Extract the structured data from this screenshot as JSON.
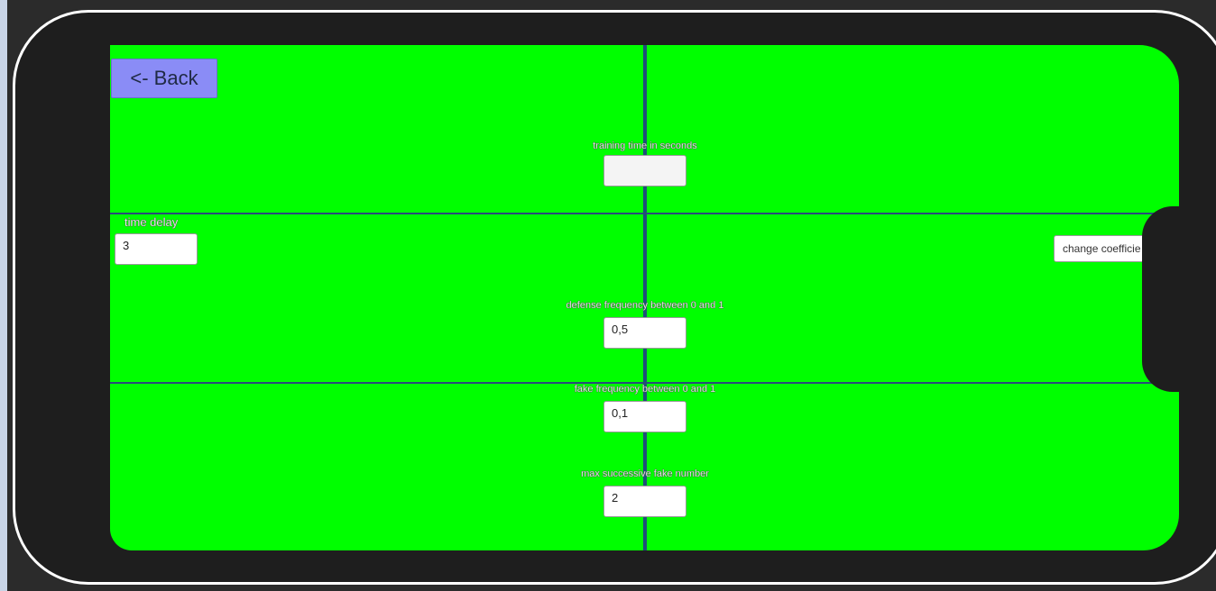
{
  "back_button": {
    "label": "<- Back"
  },
  "time_delay": {
    "label": "time delay",
    "value": "3"
  },
  "training_time": {
    "label": "training time in seconds",
    "value": ""
  },
  "defense_frequency": {
    "label": "defense frequency between 0 and 1",
    "value": "0,5"
  },
  "fake_frequency": {
    "label": "fake frequency between 0 and 1",
    "value": "0,1"
  },
  "max_fake": {
    "label": "max successive fake number",
    "value": "2"
  },
  "change_coefficients": {
    "label": "change coefficie"
  },
  "colors": {
    "screen_background": "#00ff00",
    "divider_lines": "#1f4f7a",
    "back_button": "#8a8cf6",
    "frame": "#1e1e1e"
  }
}
